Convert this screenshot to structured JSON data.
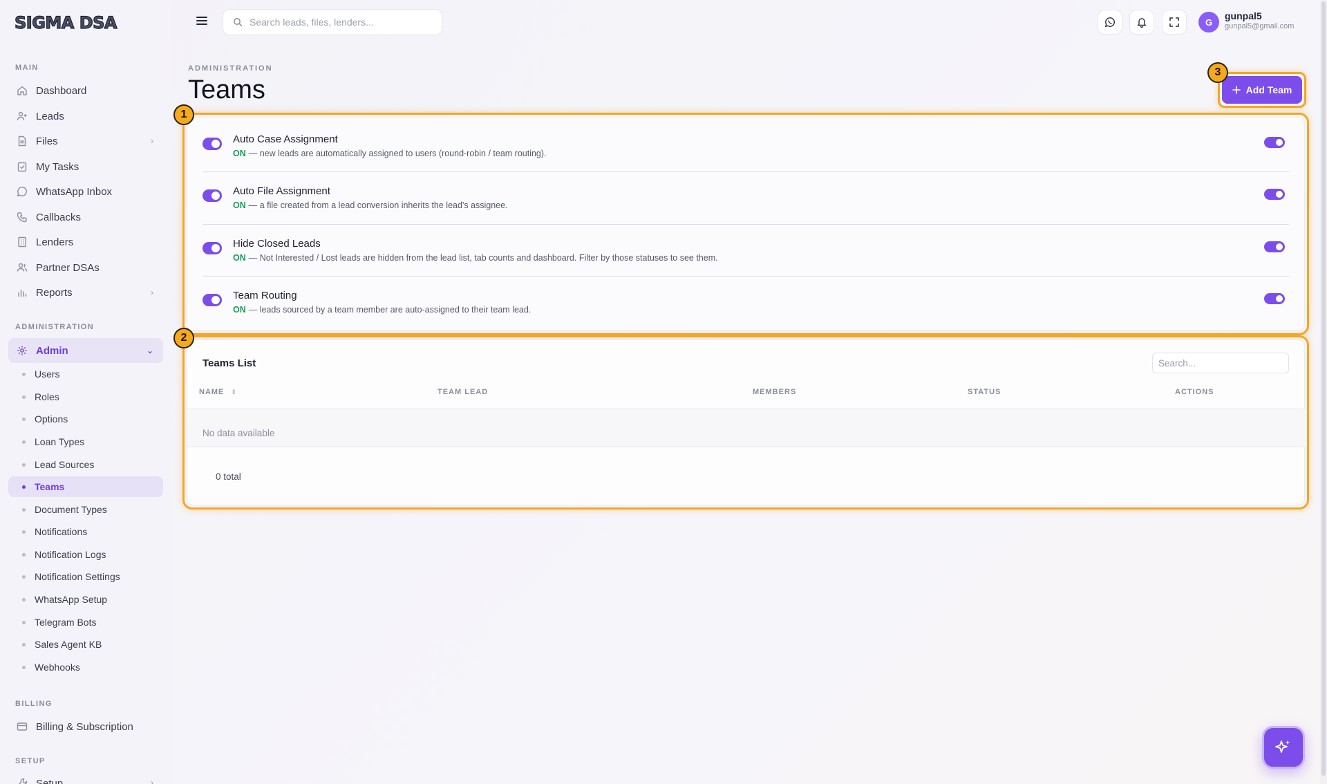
{
  "app": {
    "logo_text": "SIGMA DSA"
  },
  "sidebar": {
    "sections": {
      "main": "MAIN",
      "administration": "ADMINISTRATION",
      "billing": "BILLING",
      "setup": "SETUP"
    },
    "main_items": [
      {
        "label": "Dashboard",
        "icon": "home-icon"
      },
      {
        "label": "Leads",
        "icon": "user-plus-icon"
      },
      {
        "label": "Files",
        "icon": "file-icon",
        "has_children": true
      },
      {
        "label": "My Tasks",
        "icon": "clipboard-check-icon"
      },
      {
        "label": "WhatsApp Inbox",
        "icon": "whatsapp-icon"
      },
      {
        "label": "Callbacks",
        "icon": "phone-icon"
      },
      {
        "label": "Lenders",
        "icon": "building-icon"
      },
      {
        "label": "Partner DSAs",
        "icon": "users-icon"
      },
      {
        "label": "Reports",
        "icon": "bar-chart-icon",
        "has_children": true
      }
    ],
    "admin": {
      "label": "Admin",
      "icon": "gear-icon",
      "expanded": true,
      "children": [
        "Users",
        "Roles",
        "Options",
        "Loan Types",
        "Lead Sources",
        "Teams",
        "Document Types",
        "Notifications",
        "Notification Logs",
        "Notification Settings",
        "WhatsApp Setup",
        "Telegram Bots",
        "Sales Agent KB",
        "Webhooks"
      ],
      "active_child": "Teams"
    },
    "billing_item": {
      "label": "Billing & Subscription",
      "icon": "credit-card-icon"
    },
    "setup_item": {
      "label": "Setup",
      "icon": "wrench-icon"
    }
  },
  "topbar": {
    "search_placeholder": "Search leads, files, lenders...",
    "user": {
      "initial": "G",
      "name": "gunpal5",
      "email": "gunpal5@gmail.com"
    }
  },
  "header": {
    "breadcrumb": "ADMINISTRATION",
    "title": "Teams",
    "add_button_label": "Add Team"
  },
  "annotations": [
    "1",
    "2",
    "3"
  ],
  "settings": [
    {
      "title": "Auto Case Assignment",
      "state": "ON",
      "desc": "— new leads are automatically assigned to users (round-robin / team routing).",
      "enabled": true
    },
    {
      "title": "Auto File Assignment",
      "state": "ON",
      "desc": "— a file created from a lead conversion inherits the lead's assignee.",
      "enabled": true
    },
    {
      "title": "Hide Closed Leads",
      "state": "ON",
      "desc": "— Not Interested / Lost leads are hidden from the lead list, tab counts and dashboard. Filter by those statuses to see them.",
      "enabled": true
    },
    {
      "title": "Team Routing",
      "state": "ON",
      "desc": "— leads sourced by a team member are auto-assigned to their team lead.",
      "enabled": true
    }
  ],
  "teams_table": {
    "title": "Teams List",
    "search_placeholder": "Search...",
    "columns": [
      "NAME",
      "TEAM LEAD",
      "MEMBERS",
      "STATUS",
      "ACTIONS"
    ],
    "empty_text": "No data available",
    "total_text": "0 total"
  },
  "colors": {
    "accent": "#7c4dea",
    "highlight": "#f5a623",
    "on_green": "#13a05a"
  }
}
